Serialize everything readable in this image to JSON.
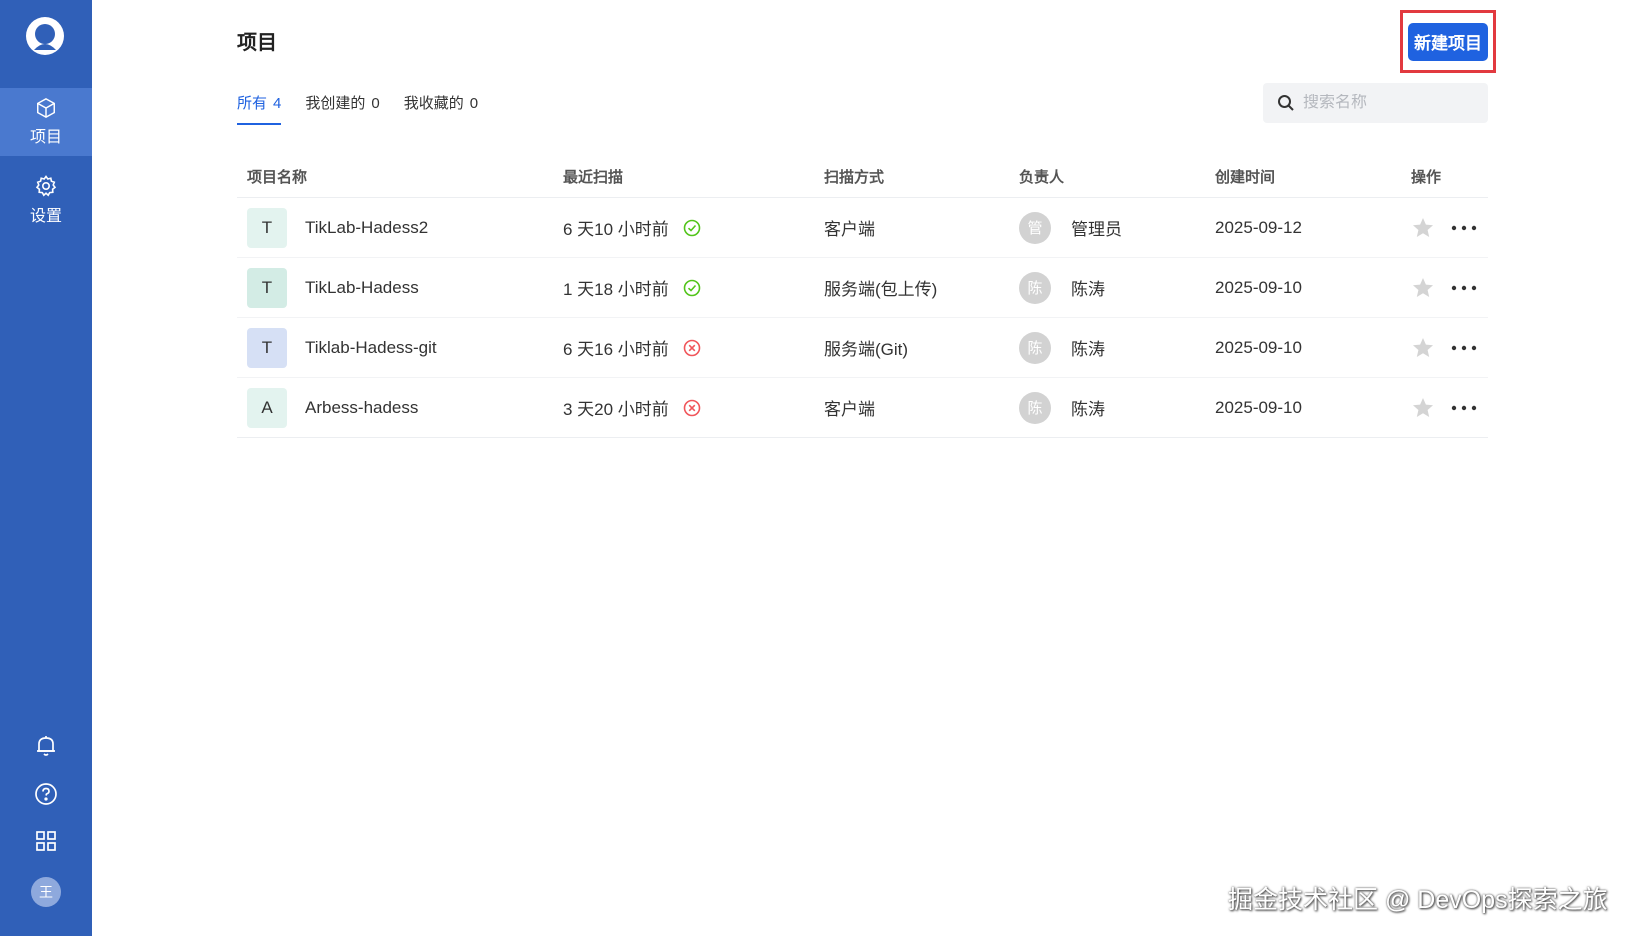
{
  "sidebar": {
    "nav": [
      {
        "label": "项目",
        "icon": "cube-icon",
        "active": true
      },
      {
        "label": "设置",
        "icon": "gear-icon",
        "active": false
      }
    ],
    "bottom_icons": [
      "bell-icon",
      "help-icon",
      "apps-grid-icon"
    ],
    "user_initial": "王"
  },
  "header": {
    "title": "项目",
    "create_label": "新建项目"
  },
  "tabs": [
    {
      "label": "所有",
      "count": "4"
    },
    {
      "label": "我创建的",
      "count": "0"
    },
    {
      "label": "我收藏的",
      "count": "0"
    }
  ],
  "search": {
    "placeholder": "搜索名称"
  },
  "table": {
    "columns": [
      "项目名称",
      "最近扫描",
      "扫描方式",
      "负责人",
      "创建时间",
      "操作"
    ],
    "rows": [
      {
        "initial": "T",
        "avatar_color": "#e3f3ef",
        "name": "TikLab-Hadess2",
        "last_scan": "6 天10 小时前",
        "scan_status": "success",
        "scan_mode": "客户端",
        "owner_initial": "管",
        "owner": "管理员",
        "created": "2025-09-12"
      },
      {
        "initial": "T",
        "avatar_color": "#d3ece5",
        "name": "TikLab-Hadess",
        "last_scan": "1 天18 小时前",
        "scan_status": "success",
        "scan_mode": "服务端(包上传)",
        "owner_initial": "陈",
        "owner": "陈涛",
        "created": "2025-09-10"
      },
      {
        "initial": "T",
        "avatar_color": "#d6e0f5",
        "name": "Tiklab-Hadess-git",
        "last_scan": "6 天16 小时前",
        "scan_status": "failed",
        "scan_mode": "服务端(Git)",
        "owner_initial": "陈",
        "owner": "陈涛",
        "created": "2025-09-10"
      },
      {
        "initial": "A",
        "avatar_color": "#e3f3ef",
        "name": "Arbess-hadess",
        "last_scan": "3 天20 小时前",
        "scan_status": "failed",
        "scan_mode": "客户端",
        "owner_initial": "陈",
        "owner": "陈涛",
        "created": "2025-09-10"
      }
    ]
  },
  "colors": {
    "sidebar": "#3060b8",
    "accent": "#1f62e0",
    "success": "#52c41a",
    "failed": "#f0555a",
    "highlight_box": "#e2393f"
  },
  "watermark": "掘金技术社区 @ DevOps探索之旅"
}
